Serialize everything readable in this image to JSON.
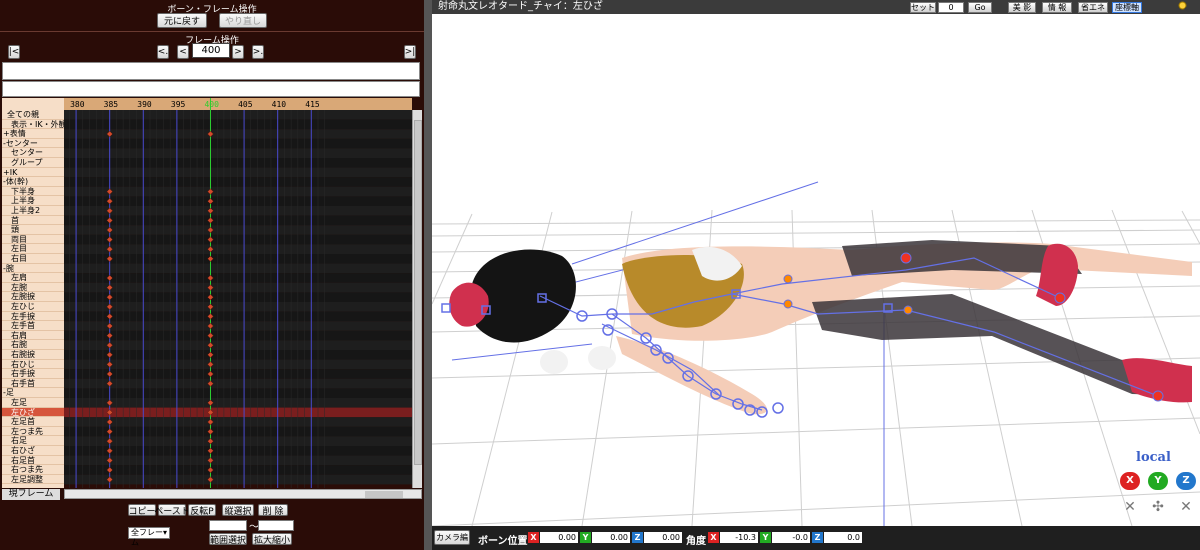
{
  "bone_frame_panel": {
    "title": "ボーン・フレーム操作",
    "undo_label": "元に戻す",
    "redo_label": "やり直し"
  },
  "frame_ops": {
    "title": "フレーム操作",
    "first_label": "|<",
    "prev_key_label": "<.",
    "prev_label": "<",
    "frame_value": "400",
    "next_label": ">",
    "next_key_label": ">.",
    "last_label": ">|"
  },
  "timeline": {
    "ruler_ticks": [
      "380",
      "385",
      "390",
      "395",
      "400",
      "405",
      "410",
      "415"
    ],
    "current_frame": 400,
    "tracks": [
      {
        "label": "全ての親",
        "indent": 1,
        "keys": []
      },
      {
        "label": "表示・IK・外観",
        "indent": 2,
        "keys": []
      },
      {
        "label": "+表情",
        "indent": 0,
        "keys": [
          385,
          400
        ]
      },
      {
        "label": "-センター",
        "indent": 0,
        "keys": []
      },
      {
        "label": "センター",
        "indent": 2,
        "keys": []
      },
      {
        "label": "グループ",
        "indent": 2,
        "keys": []
      },
      {
        "label": "+IK",
        "indent": 0,
        "keys": []
      },
      {
        "label": "-体(幹)",
        "indent": 0,
        "keys": []
      },
      {
        "label": "下半身",
        "indent": 2,
        "keys": [
          385,
          400
        ]
      },
      {
        "label": "上半身",
        "indent": 2,
        "keys": [
          385,
          400
        ]
      },
      {
        "label": "上半身2",
        "indent": 2,
        "keys": [
          385,
          400
        ]
      },
      {
        "label": "首",
        "indent": 2,
        "keys": [
          385,
          400
        ]
      },
      {
        "label": "頭",
        "indent": 2,
        "keys": [
          385,
          400
        ]
      },
      {
        "label": "両目",
        "indent": 2,
        "keys": [
          385,
          400
        ]
      },
      {
        "label": "左目",
        "indent": 2,
        "keys": [
          385,
          400
        ]
      },
      {
        "label": "右目",
        "indent": 2,
        "keys": [
          385,
          400
        ]
      },
      {
        "label": "-腕",
        "indent": 0,
        "keys": []
      },
      {
        "label": "左肩",
        "indent": 2,
        "keys": [
          385,
          400
        ]
      },
      {
        "label": "左腕",
        "indent": 2,
        "keys": [
          385,
          400
        ]
      },
      {
        "label": "左腕捩",
        "indent": 2,
        "keys": [
          385,
          400
        ]
      },
      {
        "label": "左ひじ",
        "indent": 2,
        "keys": [
          385,
          400
        ]
      },
      {
        "label": "左手捩",
        "indent": 2,
        "keys": [
          385,
          400
        ]
      },
      {
        "label": "左手首",
        "indent": 2,
        "keys": [
          385,
          400
        ]
      },
      {
        "label": "右肩",
        "indent": 2,
        "keys": [
          385,
          400
        ]
      },
      {
        "label": "右腕",
        "indent": 2,
        "keys": [
          385,
          400
        ]
      },
      {
        "label": "右腕捩",
        "indent": 2,
        "keys": [
          385,
          400
        ]
      },
      {
        "label": "右ひじ",
        "indent": 2,
        "keys": [
          385,
          400
        ]
      },
      {
        "label": "右手捩",
        "indent": 2,
        "keys": [
          385,
          400
        ]
      },
      {
        "label": "右手首",
        "indent": 2,
        "keys": [
          385,
          400
        ]
      },
      {
        "label": "-足",
        "indent": 0,
        "keys": []
      },
      {
        "label": "左足",
        "indent": 2,
        "keys": [
          385,
          400
        ]
      },
      {
        "label": "左ひざ",
        "indent": 2,
        "keys": [
          385,
          400
        ],
        "selected": true
      },
      {
        "label": "左足首",
        "indent": 2,
        "keys": [
          385,
          400
        ]
      },
      {
        "label": "左つま先",
        "indent": 2,
        "keys": [
          385,
          400
        ]
      },
      {
        "label": "右足",
        "indent": 2,
        "keys": [
          385,
          400
        ]
      },
      {
        "label": "右ひざ",
        "indent": 2,
        "keys": [
          385,
          400
        ]
      },
      {
        "label": "右足首",
        "indent": 2,
        "keys": [
          385,
          400
        ]
      },
      {
        "label": "右つま先",
        "indent": 2,
        "keys": [
          385,
          400
        ]
      },
      {
        "label": "左足調整",
        "indent": 2,
        "keys": [
          385,
          400
        ]
      }
    ]
  },
  "bottom": {
    "current_frame_label": "現フレーム",
    "copy_label": "コピー",
    "paste_label": "ペースト",
    "flip_paste_label": "反転P",
    "vertical_select_label": "縦選択",
    "delete_label": "削 除",
    "range_label": "範囲選択",
    "zoom_label": "拡大縮小",
    "frame_select_value": "全フレーム",
    "tilde": "～"
  },
  "viewer": {
    "title": "射命丸文レオタード_チャイ：左ひざ",
    "set_label": "セット",
    "set_value": "0",
    "go_label": "Go",
    "shadow_label": "影",
    "info_label": "情 報",
    "save_energy_label": "省エネ",
    "coord_axes_label": "座標軸",
    "local_label": "local",
    "axis_x": "X",
    "axis_y": "Y",
    "axis_z": "Z"
  },
  "status": {
    "camera_label": "カメラ編",
    "bone_pos_label": "ボーン位置",
    "pos_x": "0.00",
    "pos_y": "0.00",
    "pos_z": "0.00",
    "angle_label": "角度",
    "ang_x": "-10.3",
    "ang_y": "-0.0",
    "ang_z": "0.0"
  },
  "colors": {
    "panel_bg": "#2a0c07",
    "track_label_bg": "#f6dec8",
    "keyframe": "#d24b2c",
    "current_frame_line": "#2ccf2c",
    "selected_row": "#7a1e1e",
    "axis_x": "#d22",
    "axis_y": "#2a2",
    "axis_z": "#27c"
  }
}
